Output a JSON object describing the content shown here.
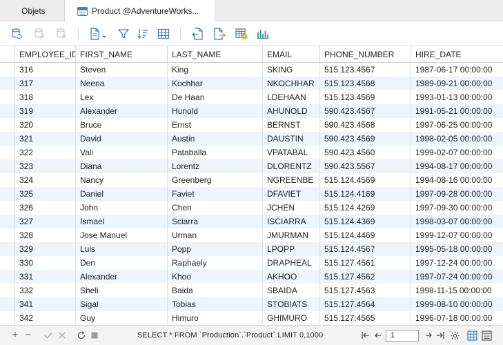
{
  "tabs": {
    "objets": "Objets",
    "product": "Product @AdventureWorks..."
  },
  "toolbar_icons": [
    "refresh-db-icon",
    "db-save-icon",
    "db-discard-icon",
    "document-export-icon",
    "filter-icon",
    "sort-icon",
    "grid-icon",
    "import-icon",
    "export-icon",
    "table-info-icon",
    "chart-icon"
  ],
  "columns": [
    "EMPLOYEE_ID",
    "FIRST_NAME",
    "LAST_NAME",
    "EMAIL",
    "PHONE_NUMBER",
    "HIRE_DATE"
  ],
  "rows": [
    [
      "316",
      "Steven",
      "King",
      "SKING",
      "515.123.4567",
      "1987-06-17 00:00:00"
    ],
    [
      "317",
      "Neena",
      "Kochhar",
      "NKOCHHAR",
      "515.123.4568",
      "1989-09-21 00:00:00"
    ],
    [
      "318",
      "Lex",
      "De Haan",
      "LDEHAAN",
      "515.123.4569",
      "1993-01-13 00:00:00"
    ],
    [
      "319",
      "Alexander",
      "Hunold",
      "AHUNOLD",
      "590.423.4567",
      "1991-05-21 00:00:00"
    ],
    [
      "320",
      "Bruce",
      "Ernst",
      "BERNST",
      "590.423.4568",
      "1997-06-25 00:00:00"
    ],
    [
      "321",
      "David",
      "Austin",
      "DAUSTIN",
      "590.423.4569",
      "1998-02-05 00:00:00"
    ],
    [
      "322",
      "Vali",
      "Pataballa",
      "VPATABAL",
      "590.423.4560",
      "1999-02-07 00:00:00"
    ],
    [
      "323",
      "Diana",
      "Lorentz",
      "DLORENTZ",
      "590.423.5567",
      "1994-08-17 00:00:00"
    ],
    [
      "324",
      "Nancy",
      "Greenberg",
      "NGREENBE",
      "515.124.4569",
      "1994-08-16 00:00:00"
    ],
    [
      "325",
      "Daniel",
      "Faviet",
      "DFAVIET",
      "515.124.4169",
      "1997-09-28 00:00:00"
    ],
    [
      "326",
      "John",
      "Chen",
      "JCHEN",
      "515.124.4269",
      "1997-09-30 00:00:00"
    ],
    [
      "327",
      "Ismael",
      "Sciarra",
      "ISCIARRA",
      "515.124.4369",
      "1998-03-07 00:00:00"
    ],
    [
      "328",
      "Jose Manuel",
      "Urman",
      "JMURMAN",
      "515.124.4469",
      "1999-12-07 00:00:00"
    ],
    [
      "329",
      "Luis",
      "Popp",
      "LPOPP",
      "515.124.4567",
      "1995-05-18 00:00:00"
    ],
    [
      "330",
      "Den",
      "Raphaely",
      "DRAPHEAL",
      "515.127.4561",
      "1997-12-24 00:00:00"
    ],
    [
      "331",
      "Alexander",
      "Khoo",
      "AKHOO",
      "515.127.4562",
      "1997-07-24 00:00:00"
    ],
    [
      "332",
      "Sheli",
      "Baida",
      "SBAIDA",
      "515.127.4563",
      "1998-11-15 00:00:00"
    ],
    [
      "341",
      "Sigal",
      "Tobias",
      "STOBIATS",
      "515.127.4564",
      "1999-08-10 00:00:00"
    ],
    [
      "342",
      "Guy",
      "Himuro",
      "GHIMURO",
      "515.127.4565",
      "1996-07-18 00:00:00"
    ]
  ],
  "statusbar": {
    "sql": "SELECT * FROM `Production`.`Product` LIMIT 0,1000",
    "page": "1"
  },
  "colors": {
    "accent": "#2f7fc1",
    "row_alt": "#edf4fa",
    "chart_teal": "#1a8c8c"
  }
}
